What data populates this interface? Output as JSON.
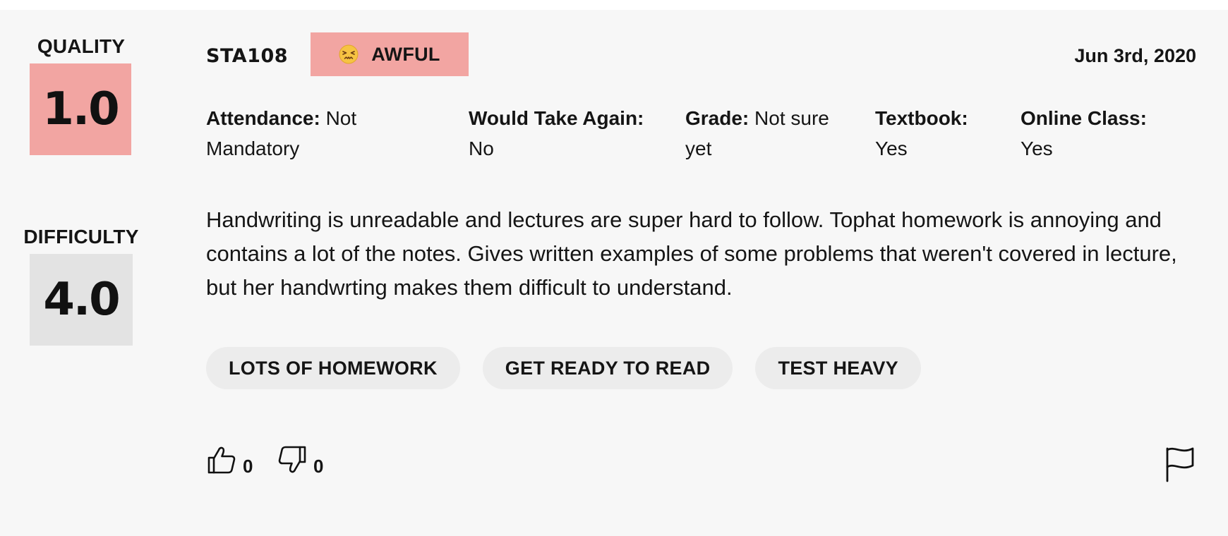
{
  "rating": {
    "quality_label": "QUALITY",
    "quality_value": "1.0",
    "difficulty_label": "DIFFICULTY",
    "difficulty_value": "4.0",
    "quality_color": "#f2a5a2",
    "difficulty_color": "#e3e3e3"
  },
  "header": {
    "course": "STA108",
    "emotion_icon": "tired-face-emoji",
    "emotion_label": "AWFUL",
    "date": "Jun 3rd, 2020"
  },
  "meta": {
    "attendance_key": "Attendance:",
    "attendance_value": "Not Mandatory",
    "would_take_again_key": "Would Take Again:",
    "would_take_again_value": "No",
    "grade_key": "Grade:",
    "grade_value": "Not sure yet",
    "textbook_key": "Textbook:",
    "textbook_value": "Yes",
    "online_class_key": "Online Class:",
    "online_class_value": "Yes"
  },
  "comment": "Handwriting is unreadable and lectures are super hard to follow. Tophat homework is annoying and contains a lot of the notes. Gives written examples of some problems that weren't covered in lecture, but her handwrting makes them difficult to understand.",
  "tags": [
    "LOTS OF HOMEWORK",
    "GET READY TO READ",
    "TEST HEAVY"
  ],
  "footer": {
    "helpful_icon": "thumbs-up-icon",
    "helpful_count": "0",
    "not_helpful_icon": "thumbs-down-icon",
    "not_helpful_count": "0",
    "report_icon": "flag-icon"
  }
}
